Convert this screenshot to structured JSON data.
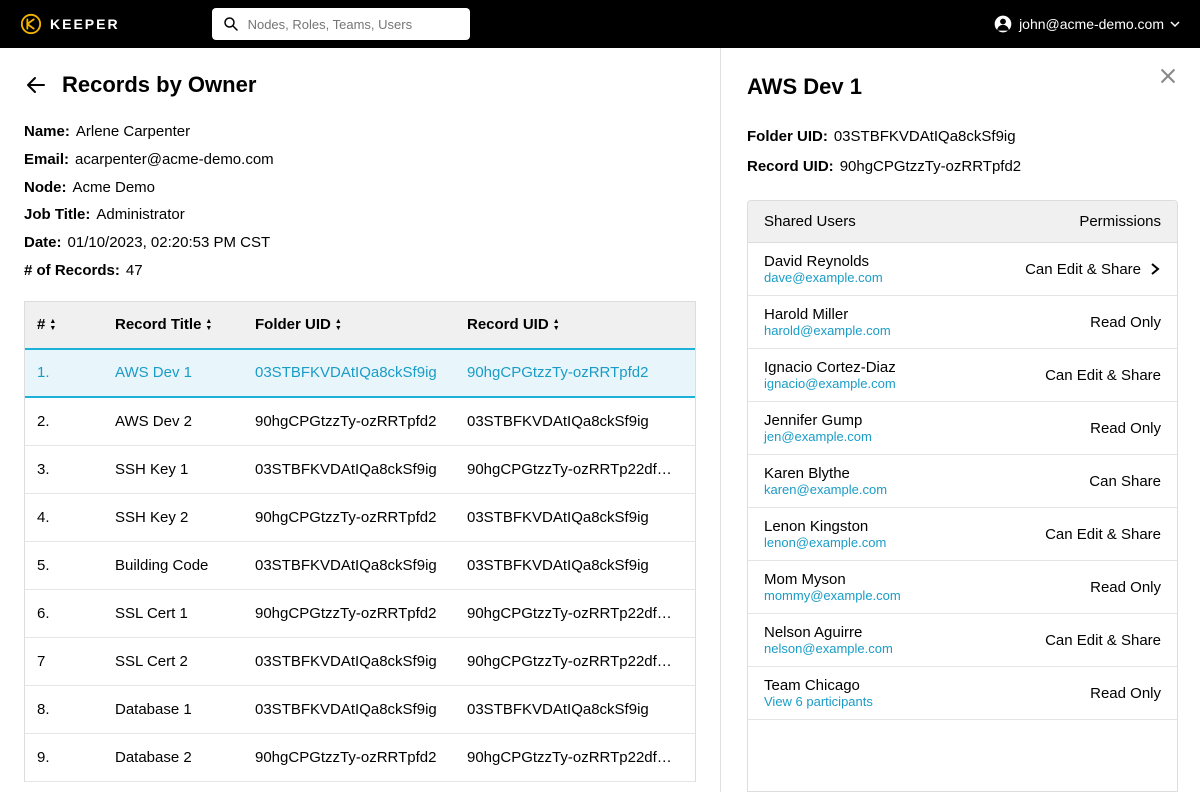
{
  "brand": {
    "name": "KEEPER"
  },
  "search": {
    "placeholder": "Nodes, Roles, Teams, Users"
  },
  "user": {
    "email": "john@acme-demo.com"
  },
  "page": {
    "title": "Records by Owner"
  },
  "owner": {
    "labels": {
      "name": "Name:",
      "email": "Email:",
      "node": "Node:",
      "job": "Job Title:",
      "date": "Date:",
      "count": "# of Records:"
    },
    "name": "Arlene Carpenter",
    "email": "acarpenter@acme-demo.com",
    "node": "Acme Demo",
    "job": "Administrator",
    "date": "01/10/2023, 02:20:53 PM CST",
    "count": "47"
  },
  "table": {
    "headers": {
      "num": "#",
      "title": "Record Title",
      "folder": "Folder UID",
      "record": "Record UID"
    },
    "rows": [
      {
        "num": "1.",
        "title": "AWS Dev 1",
        "folder": "03STBFKVDAtIQa8ckSf9ig",
        "record": "90hgCPGtzzTy-ozRRTpfd2",
        "selected": true
      },
      {
        "num": "2.",
        "title": "AWS Dev 2",
        "folder": "90hgCPGtzzTy-ozRRTpfd2",
        "record": "03STBFKVDAtIQa8ckSf9ig"
      },
      {
        "num": "3.",
        "title": "SSH Key 1",
        "folder": "03STBFKVDAtIQa8ckSf9ig",
        "record": "90hgCPGtzzTy-ozRRTp22df…"
      },
      {
        "num": "4.",
        "title": "SSH Key 2",
        "folder": "90hgCPGtzzTy-ozRRTpfd2",
        "record": "03STBFKVDAtIQa8ckSf9ig"
      },
      {
        "num": "5.",
        "title": "Building Code",
        "folder": "03STBFKVDAtIQa8ckSf9ig",
        "record": "03STBFKVDAtIQa8ckSf9ig"
      },
      {
        "num": "6.",
        "title": "SSL Cert 1",
        "folder": "90hgCPGtzzTy-ozRRTpfd2",
        "record": "90hgCPGtzzTy-ozRRTp22df…"
      },
      {
        "num": "7",
        "title": "SSL Cert 2",
        "folder": "03STBFKVDAtIQa8ckSf9ig",
        "record": "90hgCPGtzzTy-ozRRTp22df…"
      },
      {
        "num": "8.",
        "title": "Database 1",
        "folder": "03STBFKVDAtIQa8ckSf9ig",
        "record": "03STBFKVDAtIQa8ckSf9ig"
      },
      {
        "num": "9.",
        "title": "Database 2",
        "folder": "90hgCPGtzzTy-ozRRTpfd2",
        "record": "90hgCPGtzzTy-ozRRTp22df…"
      }
    ]
  },
  "panel": {
    "title": "AWS Dev 1",
    "labels": {
      "folder": "Folder UID:",
      "record": "Record UID:"
    },
    "folder_uid": "03STBFKVDAtIQa8ckSf9ig",
    "record_uid": "90hgCPGtzzTy-ozRRTpfd2",
    "headers": {
      "users": "Shared Users",
      "perms": "Permissions"
    },
    "view_participants": "View 6 participants",
    "shared": [
      {
        "name": "David Reynolds",
        "email": "dave@example.com",
        "perm": "Can Edit & Share",
        "chevron": true
      },
      {
        "name": "Harold Miller",
        "email": "harold@example.com",
        "perm": "Read Only"
      },
      {
        "name": "Ignacio Cortez-Diaz",
        "email": "ignacio@example.com",
        "perm": "Can Edit & Share"
      },
      {
        "name": "Jennifer Gump",
        "email": "jen@example.com",
        "perm": "Read Only"
      },
      {
        "name": "Karen Blythe",
        "email": "karen@example.com",
        "perm": "Can Share"
      },
      {
        "name": "Lenon Kingston",
        "email": "lenon@example.com",
        "perm": "Can Edit & Share"
      },
      {
        "name": "Mom Myson",
        "email": "mommy@example.com",
        "perm": "Read Only"
      },
      {
        "name": "Nelson Aguirre",
        "email": "nelson@example.com",
        "perm": "Can Edit & Share"
      },
      {
        "name": "Team Chicago",
        "email": "",
        "perm": "Read Only",
        "team": true
      }
    ]
  }
}
